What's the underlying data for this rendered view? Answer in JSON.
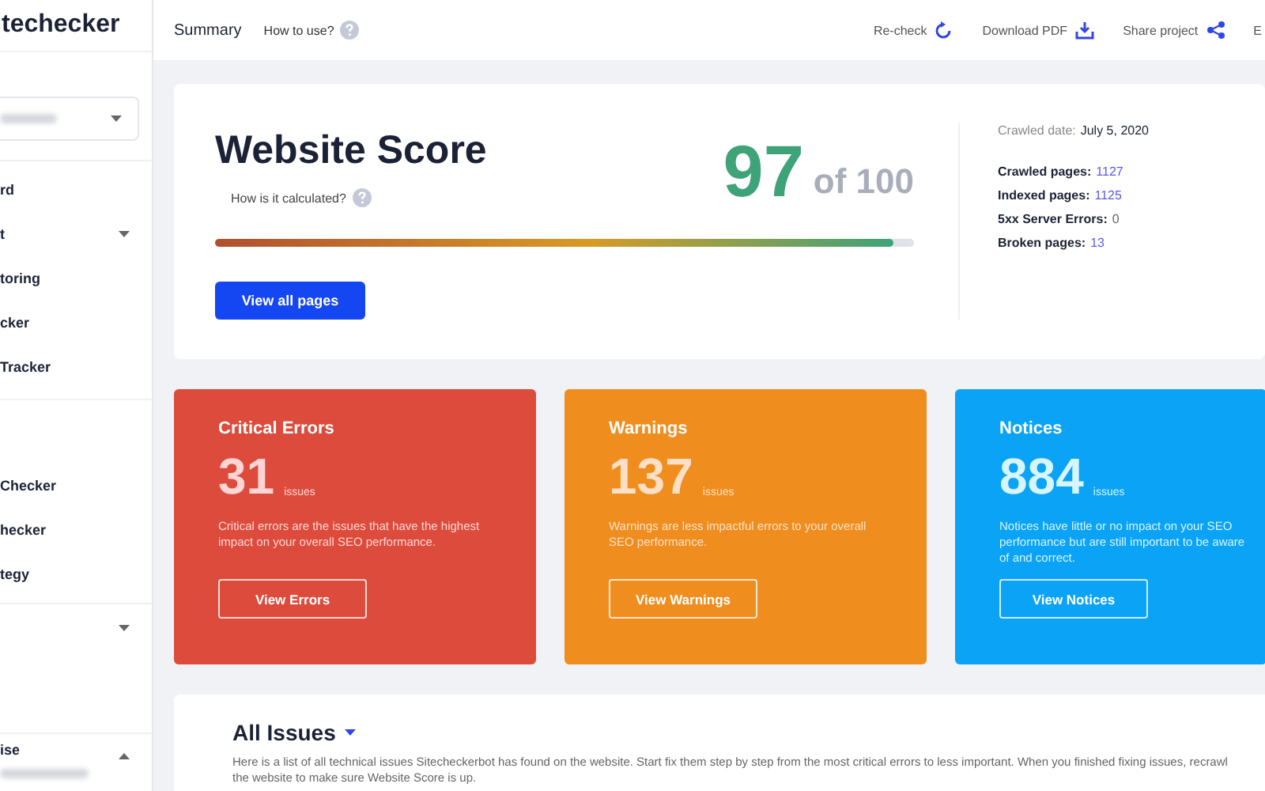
{
  "logo": {
    "text": "techecker"
  },
  "sidebar": {
    "groups": [
      {
        "items": [
          {
            "label": "rd",
            "dropdown": false
          },
          {
            "label": "t",
            "dropdown": true
          },
          {
            "label": "toring",
            "dropdown": false
          },
          {
            "label": "cker",
            "dropdown": false
          },
          {
            "label": "Tracker",
            "dropdown": false
          }
        ]
      },
      {
        "items": [
          {
            "label": "Checker",
            "dropdown": false
          },
          {
            "label": "hecker",
            "dropdown": false
          },
          {
            "label": "tegy",
            "dropdown": false
          }
        ]
      }
    ],
    "user": {
      "name": "ise"
    }
  },
  "topbar": {
    "tabs": [
      {
        "label": "Summary",
        "selected": true
      },
      {
        "label": "How to use?",
        "selected": false
      }
    ],
    "actions": [
      {
        "label": "Re-check"
      },
      {
        "label": "Download PDF"
      },
      {
        "label": "Share project"
      },
      {
        "label": "E"
      }
    ]
  },
  "score": {
    "title": "Website Score",
    "help": "How is it calculated?",
    "value": "97",
    "of": "of 100",
    "level": 0.97,
    "button": "View all pages",
    "crawled_label": "Crawled date:",
    "crawled_date": "July 5, 2020",
    "stats": [
      {
        "label": "Crawled pages:",
        "value": "1127",
        "link": true
      },
      {
        "label": "Indexed pages:",
        "value": "1125",
        "link": true
      },
      {
        "label": "5xx Server Errors:",
        "value": "0",
        "link": false
      },
      {
        "label": "Broken pages:",
        "value": "13",
        "link": true
      }
    ]
  },
  "cards": [
    {
      "kind": "error",
      "title": "Critical Errors",
      "count": "31",
      "unit": "issues",
      "description": "Critical errors are the issues that have the highest impact on your overall SEO performance.",
      "button": "View Errors"
    },
    {
      "kind": "warning",
      "title": "Warnings",
      "count": "137",
      "unit": "issues",
      "description": "Warnings are less impactful errors to your overall SEO performance.",
      "button": "View Warnings"
    },
    {
      "kind": "notice",
      "title": "Notices",
      "count": "884",
      "unit": "issues",
      "description": "Notices have little or no impact on your SEO performance but are still important to be aware of and correct.",
      "button": "View Notices"
    }
  ],
  "all_issues": {
    "title": "All Issues",
    "description": "Here is a list of all technical issues Sitecheckerbot has found on the website. Start fix them step by step from the most critical errors to less important. When you finished fixing issues, recrawl the website to make sure Website Score is up."
  }
}
